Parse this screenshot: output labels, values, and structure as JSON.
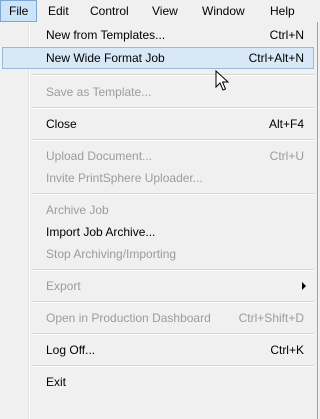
{
  "menubar": {
    "items": [
      "File",
      "Edit",
      "Control",
      "View",
      "Window",
      "Help"
    ]
  },
  "menu": {
    "new_from_templates": {
      "label": "New from Templates...",
      "shortcut": "Ctrl+N"
    },
    "new_wide_format_job": {
      "label": "New Wide Format Job",
      "shortcut": "Ctrl+Alt+N"
    },
    "save_as_template": {
      "label": "Save as Template..."
    },
    "close": {
      "label": "Close",
      "shortcut": "Alt+F4"
    },
    "upload_document": {
      "label": "Upload Document...",
      "shortcut": "Ctrl+U"
    },
    "invite_uploader": {
      "label": "Invite PrintSphere Uploader..."
    },
    "archive_job": {
      "label": "Archive Job"
    },
    "import_job_archive": {
      "label": "Import Job Archive..."
    },
    "stop_archiving": {
      "label": "Stop Archiving/Importing"
    },
    "export": {
      "label": "Export"
    },
    "open_production_dashboard": {
      "label": "Open in Production Dashboard",
      "shortcut": "Ctrl+Shift+D"
    },
    "log_off": {
      "label": "Log Off...",
      "shortcut": "Ctrl+K"
    },
    "exit": {
      "label": "Exit"
    }
  }
}
